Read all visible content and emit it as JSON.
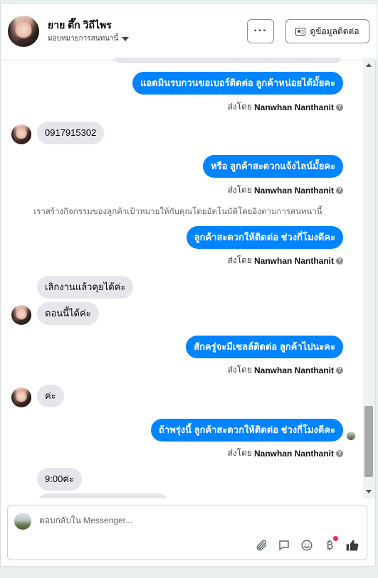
{
  "header": {
    "contact_name": "ยาย ตึ๊ก วิถีไพร",
    "assign_label": "มอบหมายการสนทนานี้",
    "more_label": "···",
    "view_info_label": "ดูข้อมูลติดต่อ"
  },
  "messages": [
    {
      "text": "แอดมินรบกวนขอเบอร์ติดต่อ ลูกค้าหน่อยได้มั้ยคะ"
    },
    {
      "text": "0917915302"
    },
    {
      "text": "หรือ ลูกค้าสะดวกแจ้งไลน์มั้ยคะ"
    },
    {
      "text": "ลูกค้าสะดวกให้ติดต่อ ช่วงกี่โมงดีคะ"
    },
    {
      "text": "เลิกงานแล้วคุยได้ค่ะ"
    },
    {
      "text": "ตอนนี้ได้ค่ะ"
    },
    {
      "text": "สักครู่จะมีเซลล์ติดต่อ ลูกค้าไปนะคะ"
    },
    {
      "text": "ค่ะ"
    },
    {
      "text": "ถ้าพรุ่งนี้ ลูกค้าสะดวกให้ติดต่อ ช่วงกี่โมงดีคะ"
    },
    {
      "text": "9:00ค่ะ"
    }
  ],
  "sent_by_prefix": "ส่งโดย",
  "sent_by_name": "Nanwhan Nanthanit",
  "system_note": "เราสร้างกิจกรรมของลูกค้าเป้าหมายให้กับคุณโดยอัตโนมัติโดยอิงตามการสนทนานี้",
  "composer": {
    "placeholder": "ตอบกลับใน Messenger..."
  },
  "icons": {
    "more": "more-dots-icon",
    "contact_card": "contact-card-icon",
    "info": "info-icon",
    "attach": "paperclip-icon",
    "saved_replies": "chat-bubble-icon",
    "emoji": "smiley-icon",
    "payment": "baht-icon",
    "like": "thumbs-up-icon"
  },
  "colors": {
    "outgoing_bubble": "#0084ff",
    "incoming_bubble": "#e4e6eb",
    "notification_dot": "#f02849"
  }
}
